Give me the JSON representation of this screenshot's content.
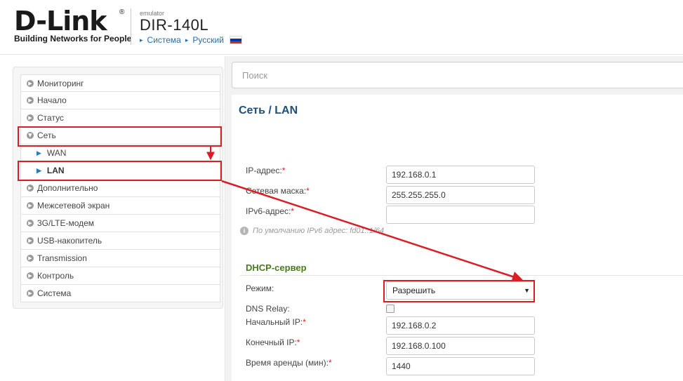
{
  "header": {
    "logo_text": "D-Link",
    "logo_reg": "®",
    "tagline": "Building Networks for People",
    "emulator": "emulator",
    "model": "DIR-140L",
    "crumb_system": "Система",
    "crumb_language": "Русский",
    "flag_colors": [
      "#ffffff",
      "#0039a6",
      "#d52b1e"
    ]
  },
  "sidebar": {
    "items": [
      {
        "label": "Мониторинг"
      },
      {
        "label": "Начало"
      },
      {
        "label": "Статус"
      },
      {
        "label": "Сеть"
      },
      {
        "label": "WAN"
      },
      {
        "label": "LAN"
      },
      {
        "label": "Дополнительно"
      },
      {
        "label": "Межсетевой экран"
      },
      {
        "label": "3G/LTE-модем"
      },
      {
        "label": "USB-накопитель"
      },
      {
        "label": "Transmission"
      },
      {
        "label": "Контроль"
      },
      {
        "label": "Система"
      }
    ]
  },
  "search": {
    "placeholder": "Поиск"
  },
  "page": {
    "title_section": "Сеть",
    "title_sep": "/",
    "title_page": "LAN"
  },
  "lan": {
    "ip_label": "IP-адрес:",
    "ip_value": "192.168.0.1",
    "mask_label": "Сетевая маска:",
    "mask_value": "255.255.255.0",
    "ipv6_label": "IPv6-адрес:",
    "ipv6_value": "",
    "hint": "По умолчанию IPv6 адрес: fd01::1/64",
    "required_mark": "*"
  },
  "dhcp": {
    "section_title": "DHCP-сервер",
    "mode_label": "Режим:",
    "mode_value": "Разрешить",
    "dns_relay_label": "DNS Relay:",
    "dns_relay_checked": false,
    "start_ip_label": "Начальный IP:",
    "start_ip_value": "192.168.0.2",
    "end_ip_label": "Конечный IP:",
    "end_ip_value": "192.168.0.100",
    "lease_label": "Время аренды (мин):",
    "lease_value": "1440"
  },
  "colors": {
    "accent": "#1d4f7a",
    "link": "#1f6fb0",
    "section": "#4a7a1f",
    "highlight": "#d81f26"
  }
}
